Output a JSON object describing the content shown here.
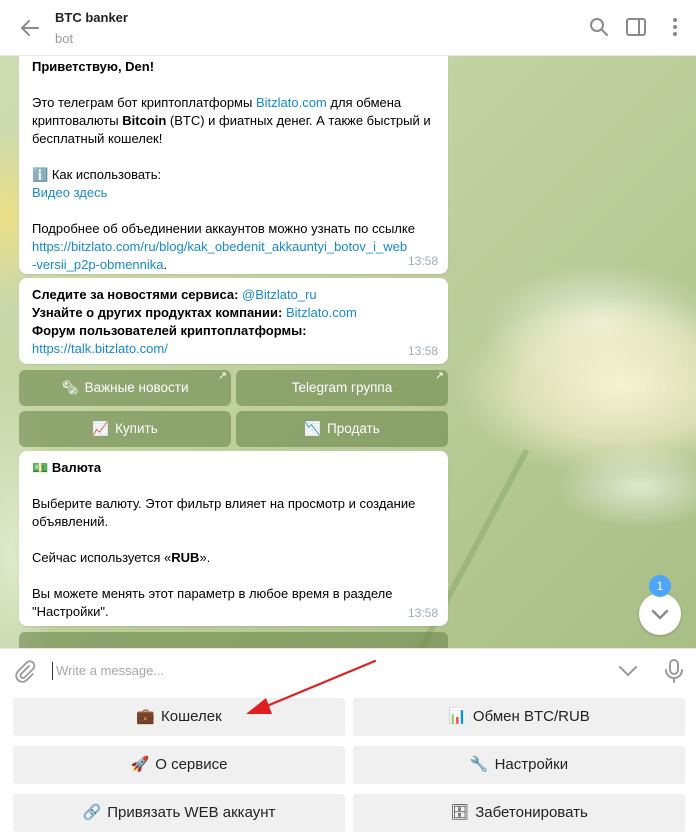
{
  "header": {
    "title": "BTC banker",
    "subtitle": "bot"
  },
  "messages": [
    {
      "greeting": "Приветствую, Den!",
      "intro_pre": "Это телеграм бот криптоплатформы ",
      "intro_link": "Bitzlato.com",
      "intro_mid": " для обмена криптовалюты ",
      "intro_bold": "Bitcoin",
      "intro_post": " (BTC) и фиатных денег. А также быстрый и бесплатный кошелек!",
      "howto_icon": "ℹ️",
      "howto": "Как использовать:",
      "video_link": "Видео здесь",
      "accounts_text": "Подробнее об объединении аккаунтов можно узнать по ссылке",
      "accounts_link_1": "https://bitzlato.com/ru/blog/kak_obedenit_akkauntyi_botov_i_web",
      "accounts_link_2": "-versii_p2p-obmennika",
      "time": "13:58"
    },
    {
      "line1_text": "Следите за новостями сервиса: ",
      "line1_link": "@Bitzlato_ru",
      "line2_text": "Узнайте о других продуктах компании: ",
      "line2_link": "Bitzlato.com",
      "line3_text": "Форум пользователей криптоплатформы:",
      "line4_link": "https://talk.bitzlato.com/",
      "time": "13:58"
    },
    {
      "title_icon": "💵",
      "title": "Валюта",
      "p1": "Выберите валюту. Этот фильтр влияет на просмотр и создание объявлений.",
      "p2_pre": "Сейчас используется «",
      "p2_bold": "RUB",
      "p2_post": "».",
      "p3": "Вы можете менять этот параметр в любое время в разделе \"Настройки\".",
      "time": "13:58"
    }
  ],
  "inline_buttons": [
    {
      "icon": "🗞",
      "label": "Важные новости",
      "url_arrow": "↗"
    },
    {
      "icon": "",
      "label": "Telegram группа",
      "url_arrow": "↗"
    },
    {
      "icon": "📈",
      "label": "Купить"
    },
    {
      "icon": "📉",
      "label": "Продать"
    }
  ],
  "scroll_badge": "1",
  "composer": {
    "placeholder": "Write a message..."
  },
  "keyboard": [
    {
      "icon": "💼",
      "label": "Кошелек"
    },
    {
      "icon": "📊",
      "label": "Обмен BTC/RUB"
    },
    {
      "icon": "🚀",
      "label": "О сервисе"
    },
    {
      "icon": "🔧",
      "label": "Настройки"
    },
    {
      "icon": "🔗",
      "label": "Привязать WEB аккаунт"
    },
    {
      "icon": "🗄",
      "label": "Забетонировать"
    }
  ],
  "colors": {
    "link": "#168acd",
    "badge": "#4ea4f6",
    "annotation_arrow": "#e02020"
  }
}
